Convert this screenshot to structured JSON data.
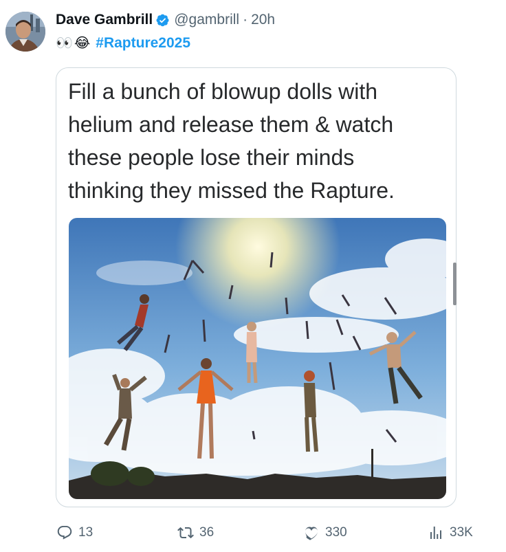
{
  "tweet": {
    "author_name": "Dave Gambrill",
    "handle": "@gambrill",
    "separator": "·",
    "time_ago": "20h",
    "line_emojis": [
      "👀",
      "😂"
    ],
    "hashtag": "#Rapture2025"
  },
  "card": {
    "text_lines": [
      "Fill a bunch of blowup dolls with",
      "helium and release them & watch",
      "these people lose their minds",
      "thinking they missed the Rapture."
    ]
  },
  "actions": {
    "replies": "13",
    "reposts": "36",
    "likes": "330",
    "views": "33K"
  },
  "icons": {
    "verified": "verified-badge-icon",
    "reply": "reply-icon",
    "repost": "repost-icon",
    "like": "heart-icon",
    "views": "analytics-icon"
  },
  "colors": {
    "link": "#1d9bf0",
    "muted": "#536471",
    "border": "#cfd9de",
    "dress": "#e8641e"
  }
}
